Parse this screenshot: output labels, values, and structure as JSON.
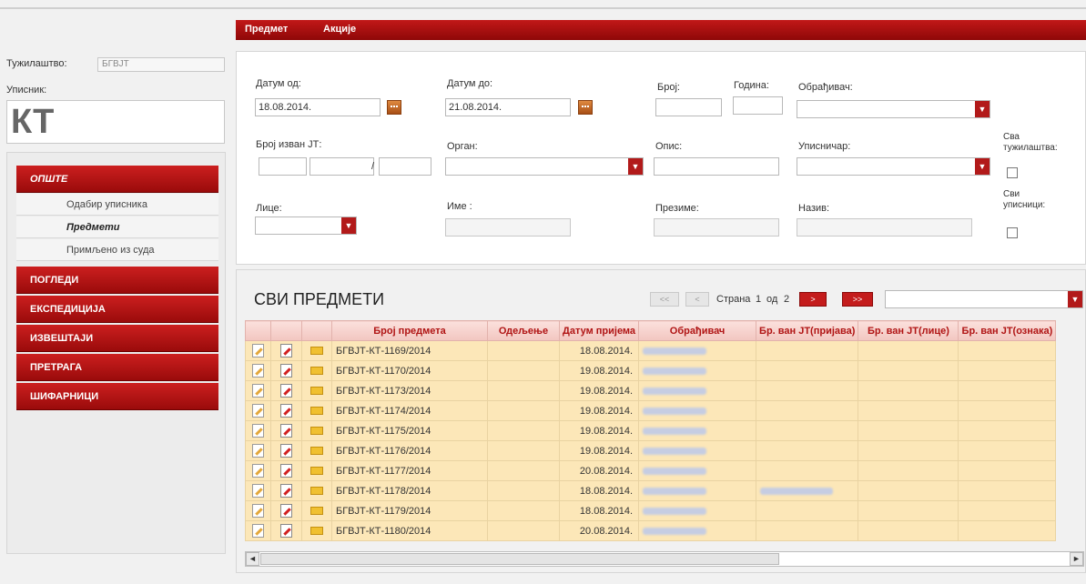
{
  "topnav": {
    "items": [
      "Предмет",
      "Акције"
    ]
  },
  "left": {
    "prosecutor_label": "Тужилаштво:",
    "prosecutor_value": "БГВЈТ",
    "registry_label": "Уписник:",
    "registry_value": "КТ",
    "menu": {
      "general": "ОПШТЕ",
      "sub": [
        "Одабир уписника",
        "Предмети",
        "Примљено из суда"
      ],
      "views": "ПОГЛЕДИ",
      "expedition": "ЕКСПЕДИЦИЈА",
      "reports": "ИЗВЕШТАЈИ",
      "search": "ПРЕТРАГА",
      "codebooks": "ШИФАРНИЦИ"
    }
  },
  "filter": {
    "date_from_label": "Датум од:",
    "date_from_value": "18.08.2014.",
    "date_to_label": "Датум до:",
    "date_to_value": "21.08.2014.",
    "number_label": "Број:",
    "year_label": "Година:",
    "processor_label": "Обрађивач:",
    "outside_number_label": "Број изван ЈТ:",
    "slash": "/",
    "organ_label": "Орган:",
    "description_label": "Опис:",
    "recorder_label": "Уписничар:",
    "all_prosecutors_label_1": "Сва",
    "all_prosecutors_label_2": "тужилаштва:",
    "person_label": "Лице:",
    "name_label": "Име :",
    "surname_label": "Презиме:",
    "title_label": "Назив:",
    "all_registries_label_1": "Сви",
    "all_registries_label_2": "уписници:"
  },
  "list": {
    "title": "СВИ ПРЕДМЕТИ",
    "pager": {
      "first": "<<",
      "prev": "<",
      "page_word": "Страна",
      "current_page": "1",
      "of_word": "од",
      "total_pages": "2",
      "next": ">",
      "last": ">>"
    },
    "columns": [
      "Број предмета",
      "Одељење",
      "Датум пријема",
      "Обрађивач",
      "Бр. ван ЈТ(пријава)",
      "Бр. ван ЈТ(лице)",
      "Бр. ван ЈТ(ознака)"
    ],
    "rows": [
      {
        "case": "БГВЈТ-КТ-1169/2014",
        "date": "18.08.2014."
      },
      {
        "case": "БГВЈТ-КТ-1170/2014",
        "date": "19.08.2014."
      },
      {
        "case": "БГВЈТ-КТ-1173/2014",
        "date": "19.08.2014."
      },
      {
        "case": "БГВЈТ-КТ-1174/2014",
        "date": "19.08.2014."
      },
      {
        "case": "БГВЈТ-КТ-1175/2014",
        "date": "19.08.2014."
      },
      {
        "case": "БГВЈТ-КТ-1176/2014",
        "date": "19.08.2014."
      },
      {
        "case": "БГВЈТ-КТ-1177/2014",
        "date": "20.08.2014."
      },
      {
        "case": "БГВЈТ-КТ-1178/2014",
        "date": "18.08.2014."
      },
      {
        "case": "БГВЈТ-КТ-1179/2014",
        "date": "18.08.2014."
      },
      {
        "case": "БГВЈТ-КТ-1180/2014",
        "date": "20.08.2014."
      }
    ],
    "scroll_left": "◄",
    "scroll_right": "►"
  },
  "colors": {
    "accent": "#b31616",
    "row_bg": "#fce7b8",
    "header_text": "#b01414"
  },
  "icons": [
    "edit-doc-icon",
    "edit-red-icon",
    "folder-icon",
    "calendar-icon",
    "dropdown-arrow-icon"
  ]
}
